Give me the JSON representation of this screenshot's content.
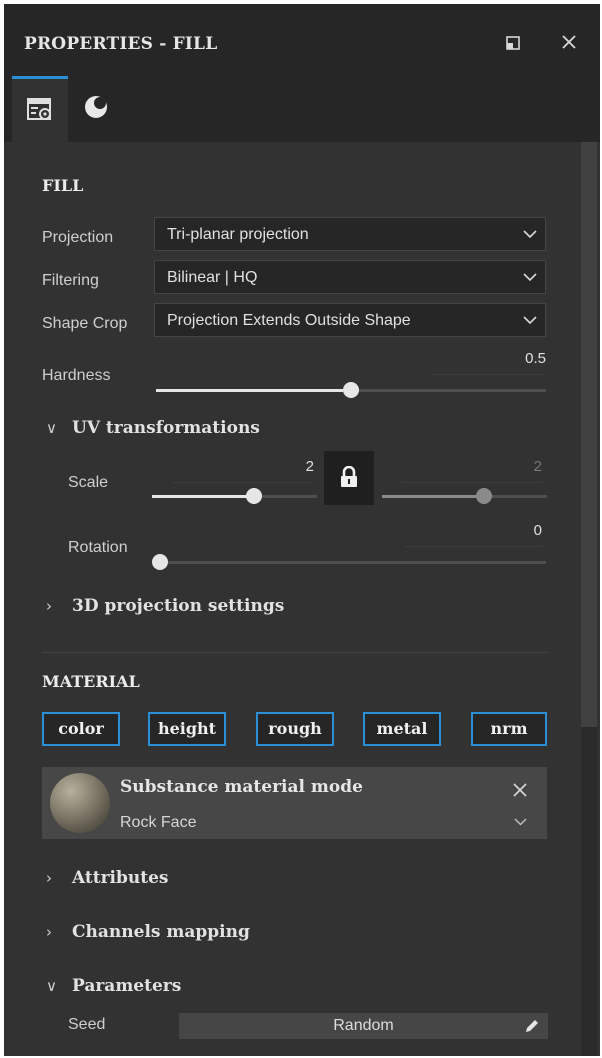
{
  "panel": {
    "title": "PROPERTIES - FILL"
  },
  "tabs": [
    {
      "icon": "properties-settings-icon",
      "active": true
    },
    {
      "icon": "material-sphere-icon",
      "active": false
    }
  ],
  "fill": {
    "section_title": "FILL",
    "projection": {
      "label": "Projection",
      "value": "Tri-planar projection"
    },
    "filtering": {
      "label": "Filtering",
      "value": "Bilinear | HQ"
    },
    "shape_crop": {
      "label": "Shape Crop",
      "value": "Projection Extends Outside Shape"
    },
    "hardness": {
      "label": "Hardness",
      "value": "0.5",
      "level": 0.5
    }
  },
  "uv": {
    "title": "UV transformations",
    "scale": {
      "label": "Scale",
      "value": "2",
      "value_locked": "2",
      "locked": true
    },
    "rotation": {
      "label": "Rotation",
      "value": "0"
    }
  },
  "projection_3d": {
    "title": "3D projection settings"
  },
  "material": {
    "section_title": "MATERIAL",
    "channels": [
      "color",
      "height",
      "rough",
      "metal",
      "nrm"
    ],
    "mode": "Substance material mode",
    "name": "Rock Face"
  },
  "collapsibles": {
    "attributes": "Attributes",
    "channels_mapping": "Channels mapping",
    "parameters": "Parameters"
  },
  "parameters": {
    "seed": {
      "label": "Seed",
      "button": "Random"
    }
  },
  "colors": {
    "accent": "#2a8fd4",
    "panel_bg": "#323232",
    "header_bg": "#262626"
  }
}
